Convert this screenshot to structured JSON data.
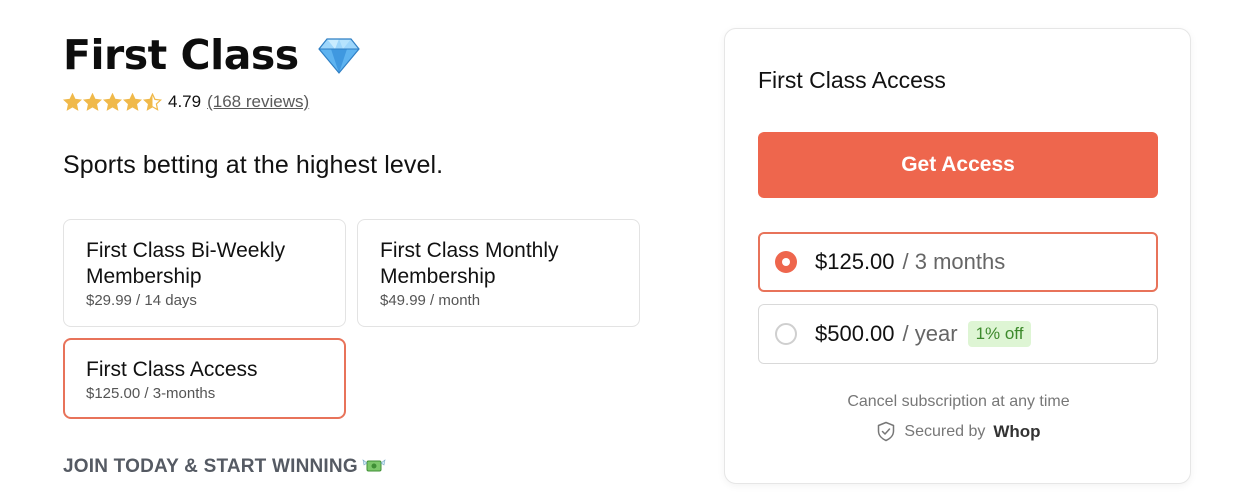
{
  "product": {
    "title": "First Class",
    "title_icon": "diamond-icon",
    "rating": {
      "value": "4.79",
      "stars": 4.79,
      "reviews_label": "(168 reviews)"
    },
    "tagline": "Sports betting at the highest level."
  },
  "plans": [
    {
      "name": "First Class Bi-Weekly Membership",
      "price": "$29.99 / 14 days",
      "selected": false
    },
    {
      "name": "First Class Monthly Membership",
      "price": "$49.99 / month",
      "selected": false
    },
    {
      "name": "First Class Access",
      "price": "$125.00 / 3-months",
      "selected": true
    }
  ],
  "cta_heading": {
    "text": "JOIN TODAY & START WINNING",
    "icon": "money-with-wings-icon"
  },
  "checkout": {
    "title": "First Class Access",
    "button_label": "Get Access",
    "options": [
      {
        "price": "$125.00",
        "period": "/ 3 months",
        "selected": true
      },
      {
        "price": "$500.00",
        "period": "/ year",
        "badge": "1% off",
        "selected": false
      }
    ],
    "cancel_note": "Cancel subscription at any time",
    "secured_label": "Secured by",
    "secured_brand": "Whop"
  },
  "colors": {
    "accent": "#ee664d",
    "selected_border": "#e8735a",
    "star": "#f0b94a",
    "badge_bg": "#def5d4",
    "badge_text": "#3d8a2c"
  }
}
